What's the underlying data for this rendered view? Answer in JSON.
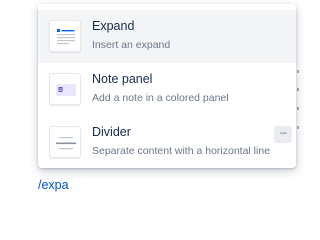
{
  "menu": {
    "items": [
      {
        "title": "Expand",
        "description": "Insert an expand",
        "icon": "expand-icon",
        "selected": true
      },
      {
        "title": "Note panel",
        "description": "Add a note in a colored panel",
        "icon": "note-panel-icon",
        "selected": false
      },
      {
        "title": "Divider",
        "description": "Separate content with a horizontal line",
        "icon": "divider-icon",
        "shortcut": "---",
        "selected": false
      }
    ]
  },
  "editor": {
    "typed_query": "/expa"
  },
  "colors": {
    "selected_background": "#f4f5f7",
    "title_text": "#172b4d",
    "description_text": "#6b778c",
    "query_text": "#0052cc",
    "note_panel_fill": "#eae6ff",
    "note_panel_accent": "#6554c0"
  }
}
